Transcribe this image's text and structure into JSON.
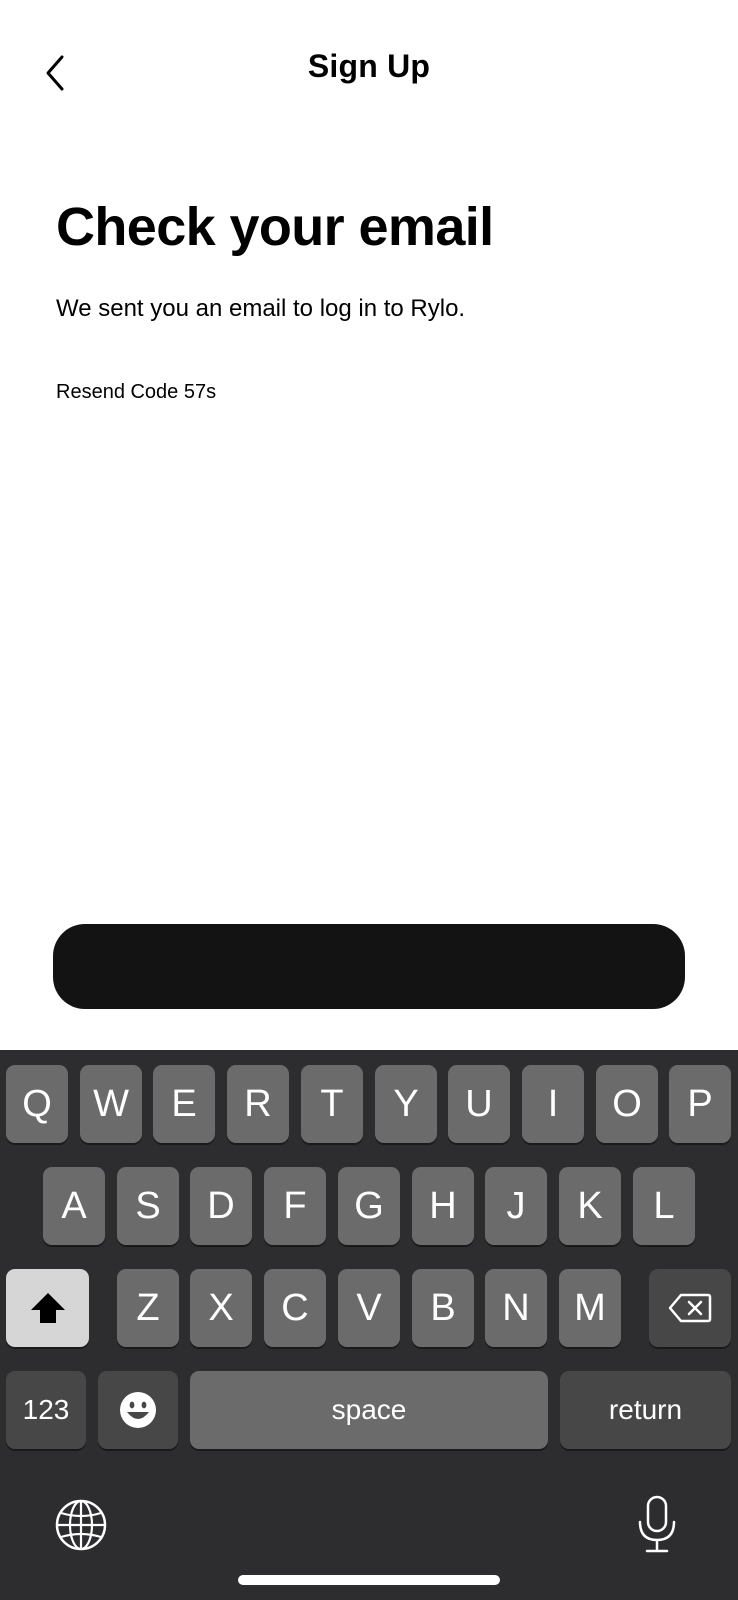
{
  "header": {
    "title": "Sign Up",
    "back_icon": "chevron-left-icon"
  },
  "main": {
    "headline": "Check your email",
    "subtext": "We sent you an email to log in to Rylo.",
    "resend_label": "Resend Code 57s"
  },
  "primary_button": {
    "label": "",
    "color": "#131313"
  },
  "keyboard": {
    "row1": [
      "Q",
      "W",
      "E",
      "R",
      "T",
      "Y",
      "U",
      "I",
      "O",
      "P"
    ],
    "row2": [
      "A",
      "S",
      "D",
      "F",
      "G",
      "H",
      "J",
      "K",
      "L"
    ],
    "row3": [
      "Z",
      "X",
      "C",
      "V",
      "B",
      "N",
      "M"
    ],
    "shift_icon": "shift-arrow-icon",
    "delete_icon": "backspace-icon",
    "numbers_label": "123",
    "emoji_icon": "emoji-icon",
    "space_label": "space",
    "return_label": "return",
    "globe_icon": "globe-icon",
    "mic_icon": "microphone-icon"
  }
}
